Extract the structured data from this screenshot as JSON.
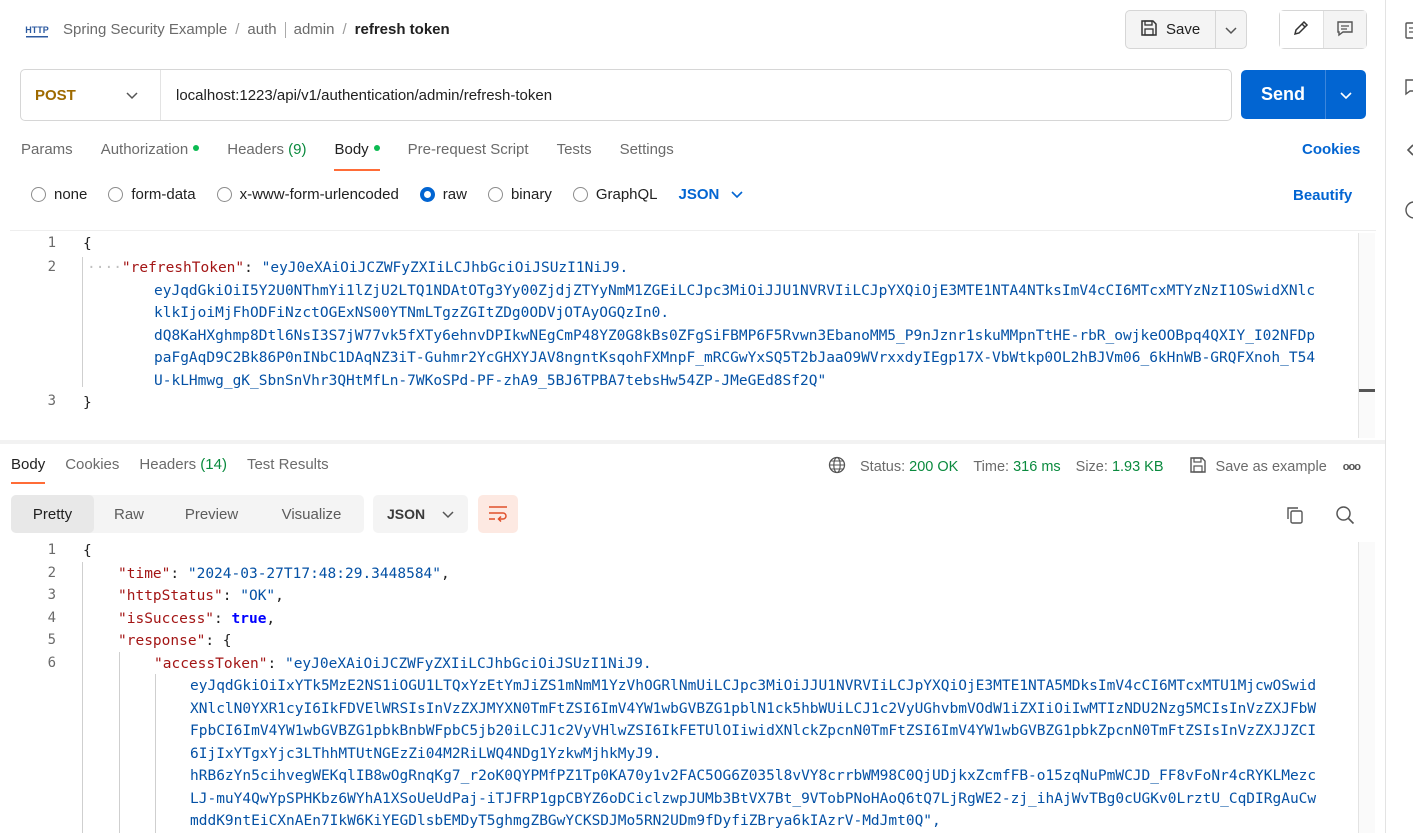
{
  "header": {
    "breadcrumb": {
      "collection": "Spring Security Example",
      "folder1": "auth",
      "folder2": "admin",
      "current": "refresh token"
    },
    "save_label": "Save"
  },
  "request": {
    "method": "POST",
    "url": "localhost:1223/api/v1/authentication/admin/refresh-token",
    "send_label": "Send"
  },
  "request_tabs": {
    "params": "Params",
    "authorization": "Authorization",
    "headers": "Headers",
    "headers_count": "(9)",
    "body": "Body",
    "pre_request": "Pre-request Script",
    "tests": "Tests",
    "settings": "Settings",
    "cookies": "Cookies"
  },
  "body_types": {
    "none": "none",
    "form_data": "form-data",
    "urlencoded": "x-www-form-urlencoded",
    "raw": "raw",
    "binary": "binary",
    "graphql": "GraphQL",
    "format": "JSON",
    "beautify": "Beautify",
    "selected": "raw"
  },
  "request_body": {
    "line_numbers": [
      "1",
      "2",
      "3"
    ],
    "open": "{",
    "key": "\"refreshToken\"",
    "colon": ": ",
    "value_lines": [
      "\"eyJ0eXAiOiJCZWFyZXIiLCJhbGciOiJSUzI1NiJ9.",
      "eyJqdGkiOiI5Y2U0NThmYi1lZjU2LTQ1NDAtOTg3Yy00ZjdjZTYyNmM1ZGEiLCJpc3MiOiJJU1NVRVIiLCJpYXQiOjE3MTE1NTA4NTksImV4cCI6MTcxMTYzNzI1OSwidXNlc",
      "klkIjoiMjFhODFiNzctOGExNS00YTNmLTgzZGItZDg0ODVjOTAyOGQzIn0.",
      "dQ8KaHXghmp8Dtl6NsI3S7jW77vk5fXTy6ehnvDPIkwNEgCmP48YZ0G8kBs0ZFgSiFBMP6F5Rvwn3EbanoMM5_P9nJznr1skuMMpnTtHE-rbR_owjkeOOBpq4QXIY_I02NFDp",
      "paFgAqD9C2Bk86P0nINbC1DAqNZ3iT-Guhmr2YcGHXYJAV8ngntKsqohFXMnpF_mRCGwYxSQ5T2bJaaO9WVrxxdyIEgp17X-VbWtkp0OL2hBJVm06_6kHnWB-GRQFXnoh_T54",
      "U-kLHmwg_gK_SbnSnVhr3QHtMfLn-7WKoSPd-PF-zhA9_5BJ6TPBA7tebsHw54ZP-JMeGEd8Sf2Q\""
    ],
    "close": "}"
  },
  "response_tabs": {
    "body": "Body",
    "cookies": "Cookies",
    "headers": "Headers",
    "headers_count": "(14)",
    "test_results": "Test Results"
  },
  "response_status": {
    "status_label": "Status:",
    "status": "200 OK",
    "time_label": "Time:",
    "time": "316 ms",
    "size_label": "Size:",
    "size": "1.93 KB",
    "save_example": "Save as example",
    "more": "ooo"
  },
  "view_modes": {
    "pretty": "Pretty",
    "raw": "Raw",
    "preview": "Preview",
    "visualize": "Visualize",
    "format": "JSON"
  },
  "response_body": {
    "line_numbers": [
      "1",
      "2",
      "3",
      "4",
      "5",
      "6"
    ],
    "l1": "{",
    "time_key": "\"time\"",
    "time_val": "\"2024-03-27T17:48:29.3448584\"",
    "status_key": "\"httpStatus\"",
    "status_val": "\"OK\"",
    "success_key": "\"isSuccess\"",
    "success_val": "true",
    "response_key": "\"response\"",
    "response_open": "{",
    "access_key": "\"accessToken\"",
    "access_lines": [
      "\"eyJ0eXAiOiJCZWFyZXIiLCJhbGciOiJSUzI1NiJ9.",
      "eyJqdGkiOiIxYTk5MzE2NS1iOGU1LTQxYzEtYmJiZS1mNmM1YzVhOGRlNmUiLCJpc3MiOiJJU1NVRVIiLCJpYXQiOjE3MTE1NTA5MDksImV4cCI6MTcxMTU1MjcwOSwid",
      "XNlclN0YXR1cyI6IkFDVElWRSIsInVzZXJMYXN0TmFtZSI6ImV4YW1wbGVBZG1pblN1ck5hbWUiLCJ1c2VyUGhvbmVOdW1iZXIiOiIwMTIzNDU2Nzg5MCIsInVzZXJFbW",
      "FpbCI6ImV4YW1wbGVBZG1pbkBnbWFpbC5jb20iLCJ1c2VyVHlwZSI6IkFETUlOIiwidXNlckZpcnN0TmFtZSI6ImV4YW1wbGVBZG1pbkZpcnN0TmFtZSIsInVzZXJJZCI",
      "6IjIxYTgxYjc3LThhMTUtNGEzZi04M2RiLWQ4NDg1YzkwMjhkMyJ9.",
      "hRB6zYn5cihvegWEKqlIB8wOgRnqKg7_r2oK0QYPMfPZ1Tp0KA70y1v2FAC5OG6Z035l8vVY8crrbWM98C0QjUDjkxZcmfFB-o15zqNuPmWCJD_FF8vFoNr4cRYKLMezc",
      "LJ-muY4QwYpSPHKbz6WYhA1XSoUeUdPaj-iTJFRP1gpCBYZ6oDCiclzwpJUMb3BtVX7Bt_9VTobPNoHAoQ6tQ7LjRgWE2-zj_ihAjWvTBg0cUGKv0LrztU_CqDIRgAuCw",
      "mddK9ntEiCXnAEn7IkW6KiYEGDlsbEMDyT5ghmgZBGwYCKSDJMo5RN2UDm9fDyfiZBrya6kIAzrV-MdJmt0Q\","
    ]
  },
  "colors": {
    "accent": "#0265d2",
    "tab_underline": "#ff6c37",
    "method": "#9e6a00",
    "ok": "#0a8a3e"
  }
}
